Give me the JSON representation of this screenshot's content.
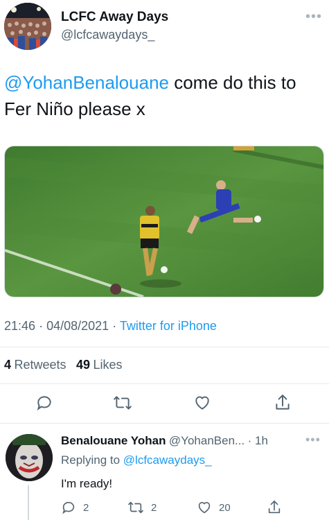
{
  "tweet": {
    "author_name": "LCFC Away Days",
    "author_handle": "@lcfcawaydays_",
    "mention": "@YohanBenalouane",
    "text_line1_rest": " come do this to",
    "text_line2": "Fer Niño please x",
    "time": "21:46",
    "separator": "·",
    "date": "04/08/2021",
    "source": "Twitter for iPhone",
    "retweets_count": "4",
    "retweets_label": "Retweets",
    "likes_count": "49",
    "likes_label": "Likes",
    "more_icon": "more-dots-icon",
    "actions": [
      "reply-icon",
      "retweet-icon",
      "like-icon",
      "share-icon"
    ]
  },
  "reply": {
    "author_name": "Benalouane Yohan",
    "author_handle": "@YohanBen...",
    "age": "· 1h",
    "replying_label": "Replying to",
    "replying_handle": "@lcfcawaydays_",
    "text": "I'm ready!",
    "reply_count": "2",
    "retweet_count": "2",
    "like_count": "20"
  },
  "colors": {
    "accent": "#1d9bf0",
    "text": "#0f1419",
    "secondary": "#536471",
    "pitch": "#4f8b3a"
  }
}
